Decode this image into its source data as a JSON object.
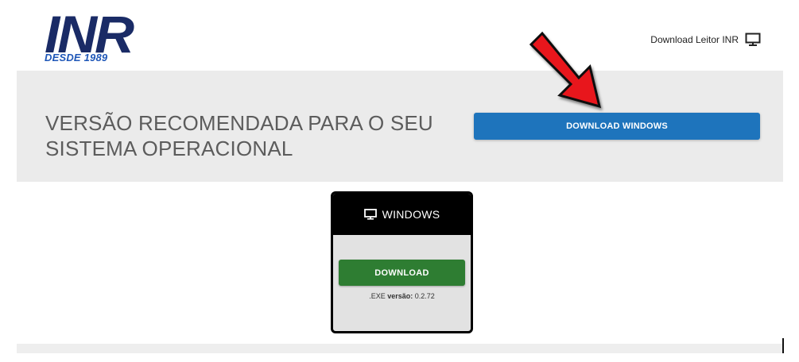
{
  "header": {
    "logo": {
      "main": "INR",
      "sub": "DESDE 1989"
    },
    "reader_link": {
      "label": "Download Leitor INR",
      "icon": "monitor-icon"
    }
  },
  "hero": {
    "title": "VERSÃO RECOMENDADA PARA O SEU SISTEMA OPERACIONAL",
    "button_label": "DOWNLOAD WINDOWS"
  },
  "card": {
    "title": "WINDOWS",
    "icon": "monitor-icon",
    "button_label": "DOWNLOAD",
    "version_prefix": ".EXE",
    "version_label": "versão:",
    "version_value": "0.2.72"
  },
  "annotation": {
    "arrow_color": "#e8131b",
    "arrow_icon": "red-arrow-icon"
  },
  "colors": {
    "brand_navy": "#1a2b66",
    "brand_blue": "#1f57b8",
    "primary_blue": "#1e74bc",
    "download_green": "#2e7d32",
    "hero_bg": "#ebebeb",
    "card_bg": "#e2e2e2"
  }
}
